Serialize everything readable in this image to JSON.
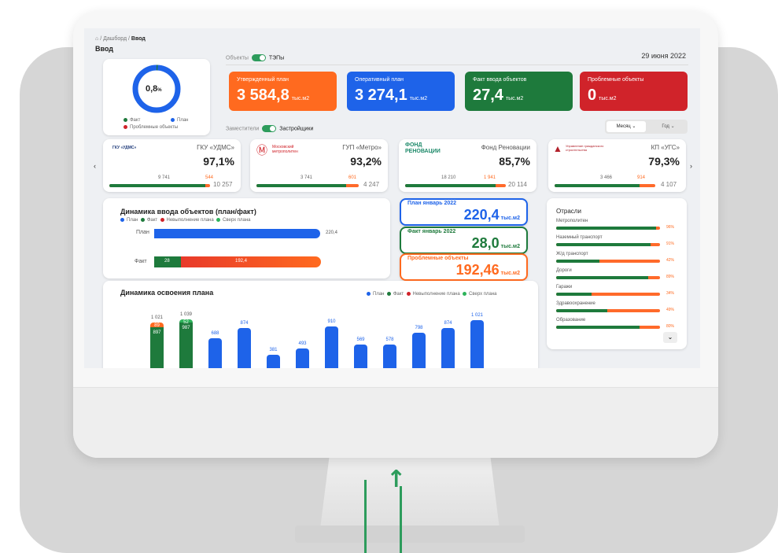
{
  "breadcrumb": {
    "home_icon": "home-icon",
    "sep1": "/",
    "item1": "Дашборд",
    "sep2": "/",
    "current": "Ввод"
  },
  "page_title": "Ввод",
  "date": "29 июня 2022",
  "donut": {
    "value": "0,8",
    "unit": "%",
    "fraction": 0.008,
    "legend": [
      "Факт",
      "План",
      "Проблемные объекты"
    ]
  },
  "toggle1": {
    "left": "Объекты",
    "right": "ТЭПы"
  },
  "toggle2": {
    "left": "Заместители",
    "right": "Застройщики"
  },
  "period": {
    "month": "Месяц",
    "year": "Год"
  },
  "kpis": [
    {
      "label": "Утвержденный план",
      "value": "3 584,8",
      "unit": "тыс.м2",
      "color": "#ff6a1f"
    },
    {
      "label": "Оперативный план",
      "value": "3 274,1",
      "unit": "тыс.м2",
      "color": "#1e63e9"
    },
    {
      "label": "Факт ввода объектов",
      "value": "27,4",
      "unit": "тыс.м2",
      "color": "#1e7a3c"
    },
    {
      "label": "Проблемные объекты",
      "value": "0",
      "unit": "тыс.м2",
      "color": "#d0232a"
    }
  ],
  "orgs": [
    {
      "name": "ГКУ «УДМС»",
      "logo": "ГКУ «УДМС»",
      "pct": "97,1%",
      "a": "9 741",
      "b": "544",
      "total": "10 257",
      "fill": 0.95
    },
    {
      "name": "ГУП «Метро»",
      "logo": "Московский метрополитен",
      "pct": "93,2%",
      "a": "3 741",
      "b": "601",
      "total": "4 247",
      "fill": 0.88
    },
    {
      "name": "Фонд Реновации",
      "logo": "ФОНД РЕНОВАЦИИ",
      "pct": "85,7%",
      "a": "18 210",
      "b": "1 941",
      "total": "20 114",
      "fill": 0.9
    },
    {
      "name": "КП «УГС»",
      "logo": "Управление гражданского строительства",
      "pct": "79,3%",
      "a": "3 466",
      "b": "914",
      "total": "4 107",
      "fill": 0.84
    }
  ],
  "dyn1": {
    "title": "Динамика ввода объектов (план/факт)",
    "legend": [
      "План",
      "Факт",
      "Невыполнение плана",
      "Сверх плана"
    ],
    "plan_label": "План",
    "plan_value": "220,4",
    "fact_label": "Факт",
    "fact_value": "28",
    "fail_value": "192,4"
  },
  "stats": [
    {
      "label": "План январь 2022",
      "value": "220,4",
      "unit": "тыс.м2",
      "color": "#1e63e9"
    },
    {
      "label": "Факт январь 2022",
      "value": "28,0",
      "unit": "тыс.м2",
      "color": "#1e7a3c"
    },
    {
      "label": "Проблемные объекты",
      "value": "192,46",
      "unit": "тыс.м2",
      "color": "#ff6a1f"
    }
  ],
  "industries": {
    "title": "Отрасли",
    "items": [
      {
        "name": "Метрополитен",
        "pct": "96%",
        "v": 0.96
      },
      {
        "name": "Наземный транспорт",
        "pct": "91%",
        "v": 0.91
      },
      {
        "name": "Ж/д транспорт",
        "pct": "42%",
        "v": 0.42
      },
      {
        "name": "Дороги",
        "pct": "89%",
        "v": 0.89
      },
      {
        "name": "Гаражи",
        "pct": "34%",
        "v": 0.34
      },
      {
        "name": "Здравоохранение",
        "pct": "49%",
        "v": 0.49
      },
      {
        "name": "Образование",
        "pct": "80%",
        "v": 0.8
      }
    ]
  },
  "dyn2": {
    "title": "Динамика освоения плана",
    "legend": [
      "План",
      "Факт",
      "Невыполнение плана",
      "Сверх плана"
    ]
  },
  "chart_data": {
    "type": "bar",
    "title": "Динамика освоения плана",
    "series": [
      {
        "name": "План",
        "values": [
          1021,
          1039,
          688,
          874,
          381,
          493,
          910,
          569,
          578,
          798,
          874,
          1021
        ]
      },
      {
        "name": "Факт",
        "values": [
          897,
          987,
          null,
          null,
          null,
          null,
          null,
          null,
          null,
          null,
          null,
          null
        ]
      },
      {
        "name": "Невыполнение плана",
        "values": [
          89,
          null,
          null,
          null,
          null,
          null,
          null,
          null,
          null,
          null,
          null,
          null
        ]
      },
      {
        "name": "Сверх плана",
        "values": [
          null,
          52,
          null,
          null,
          null,
          null,
          null,
          null,
          null,
          null,
          null,
          null
        ]
      }
    ],
    "labels": [
      "1 021",
      "1 039",
      "688",
      "874",
      "381",
      "493",
      "910",
      "569",
      "578",
      "798",
      "874",
      "1 021"
    ],
    "ylim": [
      0,
      1100
    ]
  },
  "colors": {
    "plan": "#1e63e9",
    "fact": "#1e7a3c",
    "fail": "#ff6a1f",
    "over": "#2db35a"
  },
  "icons": {
    "home": "home-icon",
    "prev": "chevron-left-icon",
    "next": "chevron-right-icon",
    "expand": "chevron-down-icon"
  }
}
